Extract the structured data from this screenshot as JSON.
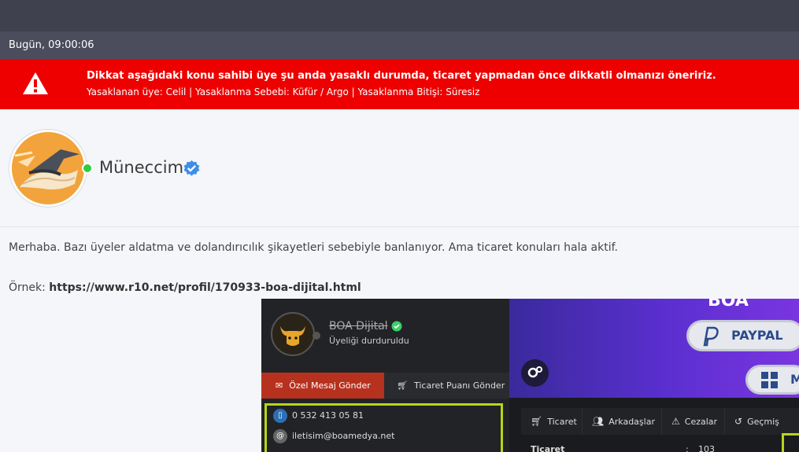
{
  "header": {
    "timestamp": "Bugün, 09:00:06"
  },
  "alert": {
    "icon": "warning-triangle-icon",
    "title": "Dikkat aşağıdaki konu sahibi üye şu anda yasaklı durumda, ticaret yapmadan önce dikkatli olmanızı öneririz.",
    "detail": "Yasaklanan üye: Celil | Yasaklanma Sebebi: Küfür / Argo | Yasaklanma Bitişi: Süresiz",
    "background": "#ee0000"
  },
  "author": {
    "name": "Müneccim",
    "status": "online",
    "verified_icon": "verified-badge-icon"
  },
  "post": {
    "text": "Merhaba. Bazı üyeler aldatma ve dolandırıcılık şikayetleri sebebiyle banlanıyor. Ama ticaret konuları hala aktif.",
    "example_label": "Örnek:",
    "example_link": "https://www.r10.net/profil/170933-boa-dijital.html"
  },
  "embedded_screenshot": {
    "profile_name": "BOA Dijital",
    "profile_status": "Üyeliği durduruldu",
    "buttons": {
      "message": "Özel Mesaj Gönder",
      "trade_points": "Ticaret Puanı Gönder"
    },
    "contacts": [
      {
        "icon": "phone-icon",
        "text": "0 532 413 05 81"
      },
      {
        "icon": "at-icon",
        "text": "iletisim@boamedya.net"
      }
    ],
    "banner": {
      "paypal_label": "PAYPAL",
      "grid_label": "M"
    },
    "tabs": [
      {
        "icon": "cart-icon",
        "label": "Ticaret"
      },
      {
        "icon": "friends-icon",
        "label": "Arkadaşlar"
      },
      {
        "icon": "warning-icon",
        "label": "Cezalar"
      },
      {
        "icon": "history-icon",
        "label": "Geçmiş"
      }
    ],
    "stats": {
      "label": "Ticaret",
      "value": "103"
    },
    "highlight_color": "#b5d619"
  }
}
